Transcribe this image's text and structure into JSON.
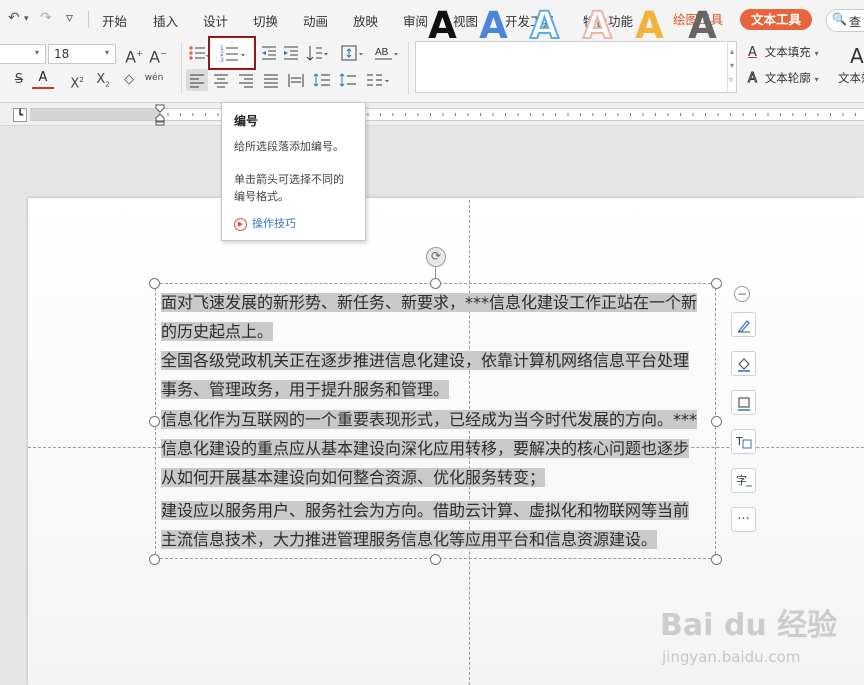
{
  "quick_access": {
    "undo": "↶",
    "undo_arrow": "▾",
    "redo": "↷",
    "customize": "▿"
  },
  "menu": {
    "items": [
      "开始",
      "插入",
      "设计",
      "切换",
      "动画",
      "放映",
      "审阅",
      "视图",
      "开发工具",
      "特色功能"
    ],
    "drawing_tools": "绘图工具",
    "text_tools": "文本工具",
    "search_icon": "🔍",
    "search_text": "查"
  },
  "ribbon": {
    "font_name": "",
    "font_size": "18",
    "grow_font": "A",
    "shrink_font": "A",
    "strike": "S",
    "font_color": "A",
    "superscript": "X",
    "subscript": "X",
    "clear_format": "◇",
    "phonetic": "wén",
    "text_fill": "文本填充",
    "text_outline": "文本轮廓",
    "text_effect": "文本效",
    "style_gallery": [
      {
        "letter": "A",
        "color": "#111111"
      },
      {
        "letter": "A",
        "color": "#4a86d8"
      },
      {
        "letter": "A",
        "color": "#5aaee0"
      },
      {
        "letter": "A",
        "color": "#f0b4a6"
      },
      {
        "letter": "A",
        "color": "#f0b43c"
      },
      {
        "letter": "A",
        "color": "#666666"
      }
    ]
  },
  "tooltip": {
    "title": "编号",
    "line1": "给所选段落添加编号。",
    "line2": "单击箭头可选择不同的",
    "line3": "编号格式。",
    "link": "操作技巧"
  },
  "document": {
    "paragraphs": [
      [
        "面对飞速发展的新形势、新任务、新要求，***信息化建设工作正站在一个新",
        "的历史起点上。"
      ],
      [
        "全国各级党政机关正在逐步推进信息化建设，依靠计算机网络信息平台处理",
        "事务、管理政务，用于提升服务和管理。"
      ],
      [
        "信息化作为互联网的一个重要表现形式，已经成为当今时代发展的方向。***",
        "信息化建设的重点应从基本建设向深化应用转移，要解决的核心问题也逐步",
        "从如何开展基本建设向如何整合资源、优化服务转变；"
      ],
      [
        "建设应以服务用户、服务社会为方向。借助云计算、虚拟化和物联网等当前",
        "主流信息技术，大力推进管理服务信息化等应用平台和信息资源建设。"
      ]
    ]
  },
  "floating_toolbar": {
    "collapse": "−",
    "more": "···"
  },
  "watermark": {
    "logo": "Bai du 经验",
    "url": "jingyan.baidu.com"
  }
}
